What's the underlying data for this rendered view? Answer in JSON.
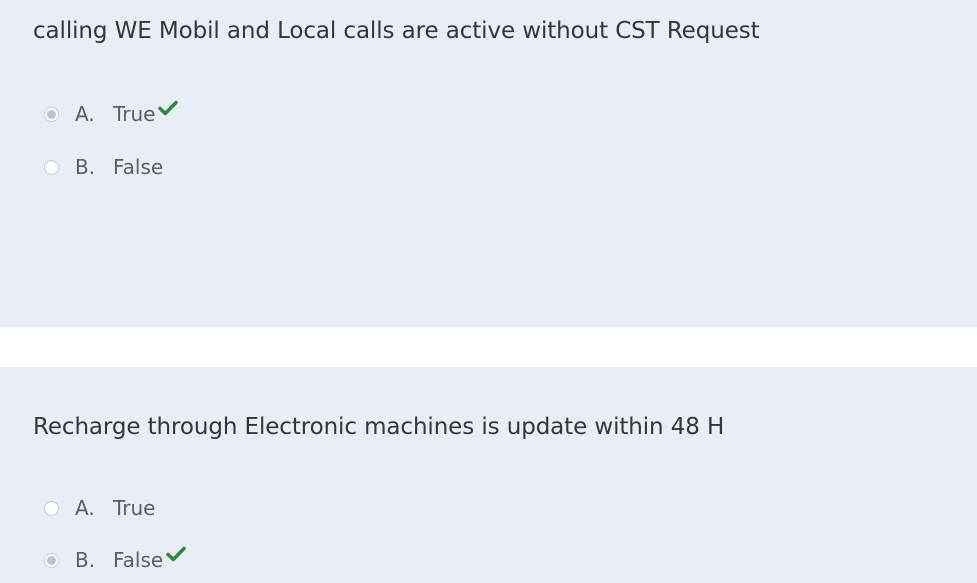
{
  "questions": [
    {
      "text": "calling WE Mobil and Local calls are active without CST Request",
      "options": [
        {
          "letter": "A.",
          "label": "True",
          "selected": true,
          "correct": true
        },
        {
          "letter": "B.",
          "label": "False",
          "selected": false,
          "correct": false
        }
      ]
    },
    {
      "text": "Recharge through Electronic machines is update within 48 H",
      "options": [
        {
          "letter": "A.",
          "label": "True",
          "selected": false,
          "correct": false
        },
        {
          "letter": "B.",
          "label": "False",
          "selected": true,
          "correct": true
        }
      ]
    }
  ],
  "colors": {
    "card_background": "#e9edf5",
    "text": "#33363b",
    "option_text": "#5a5e66",
    "correct_check": "#2e8b3a"
  },
  "icons": {
    "correct": "checkmark-icon",
    "radio": "radio-button"
  }
}
